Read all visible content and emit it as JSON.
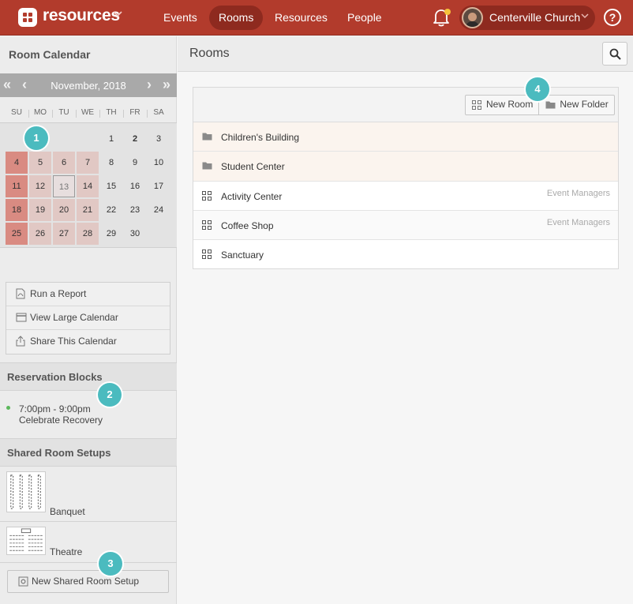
{
  "topbar": {
    "app_name": "resources",
    "nav": [
      "Events",
      "Rooms",
      "Resources",
      "People"
    ],
    "active_nav": "Rooms",
    "org_name": "Centerville Church",
    "help_label": "?",
    "colors": {
      "bar": "#b23b2c",
      "active_pill": "#8e2a1f",
      "notification_dot": "#f6c23b"
    }
  },
  "sidebar": {
    "title": "Room Calendar",
    "calendar": {
      "prev_year": "«",
      "prev_month": "‹",
      "month_label": "November, 2018",
      "next_month": "›",
      "next_year": "»",
      "weekdays": [
        "SU",
        "MO",
        "TU",
        "WE",
        "TH",
        "FR",
        "SA"
      ],
      "today": "13"
    },
    "actions": [
      "Run a Report",
      "View Large Calendar",
      "Share This Calendar"
    ],
    "reservation_blocks": {
      "title": "Reservation Blocks",
      "items": [
        {
          "time": "7:00pm - 9:00pm",
          "name": "Celebrate Recovery"
        }
      ]
    },
    "shared_setups": {
      "title": "Shared Room Setups",
      "items": [
        "Banquet",
        "Theatre"
      ],
      "new_button": "New Shared Room Setup"
    }
  },
  "main": {
    "title": "Rooms",
    "toolbar": {
      "new_room": "New Room",
      "new_folder": "New Folder"
    },
    "rows": [
      {
        "type": "folder",
        "name": "Children's Building",
        "group": ""
      },
      {
        "type": "folder",
        "name": "Student Center",
        "group": ""
      },
      {
        "type": "room",
        "name": "Activity Center",
        "group": "Event Managers"
      },
      {
        "type": "room",
        "name": "Coffee Shop",
        "group": "Event Managers"
      },
      {
        "type": "room",
        "name": "Sanctuary",
        "group": ""
      }
    ]
  },
  "badges": [
    "1",
    "2",
    "3",
    "4"
  ],
  "icons": [
    "grid-logo-icon",
    "chevron-down-icon",
    "bell-icon",
    "help-icon",
    "search-icon",
    "pdf-icon",
    "calendar-icon",
    "share-icon",
    "gear-icon",
    "grid-icon",
    "folder-icon"
  ]
}
